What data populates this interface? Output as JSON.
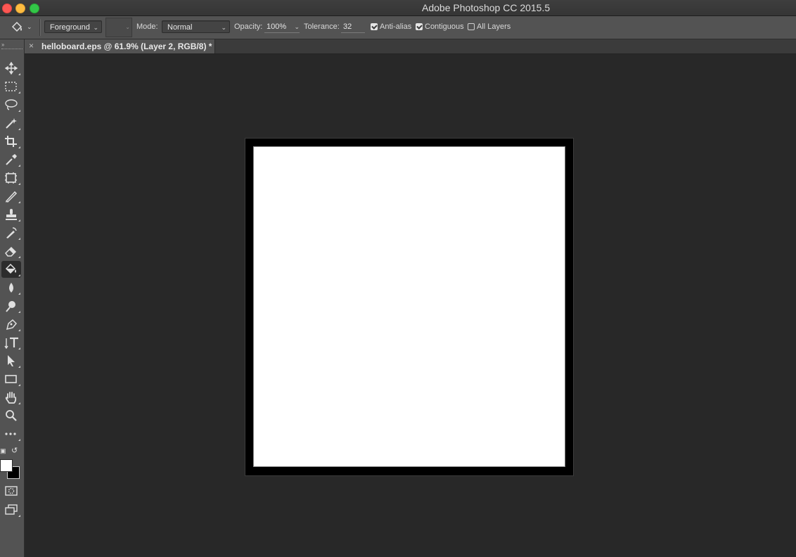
{
  "window": {
    "title": "Adobe Photoshop CC 2015.5"
  },
  "options": {
    "fill_source": "Foreground",
    "mode_label": "Mode:",
    "mode_value": "Normal",
    "opacity_label": "Opacity:",
    "opacity_value": "100%",
    "tolerance_label": "Tolerance:",
    "tolerance_value": "32",
    "antialias_label": "Anti-alias",
    "antialias_checked": true,
    "contiguous_label": "Contiguous",
    "contiguous_checked": true,
    "alllayers_label": "All Layers",
    "alllayers_checked": false
  },
  "document_tab": {
    "title": "helloboard.eps @ 61.9% (Layer 2, RGB/8) *"
  },
  "tools": [
    "move-icon",
    "marquee-icon",
    "lasso-icon",
    "magic-wand-icon",
    "crop-icon",
    "eyedropper-icon",
    "frame-icon",
    "brush-icon",
    "stamp-icon",
    "history-brush-icon",
    "eraser-icon",
    "paint-bucket-icon",
    "blur-icon",
    "dodge-icon",
    "pen-icon",
    "type-icon",
    "path-selection-icon",
    "rectangle-icon",
    "hand-icon",
    "zoom-icon",
    "more-icon",
    "quick-mask-icon",
    "screen-mode-icon"
  ],
  "colors": {
    "foreground": "#ffffff",
    "background": "#000000"
  }
}
